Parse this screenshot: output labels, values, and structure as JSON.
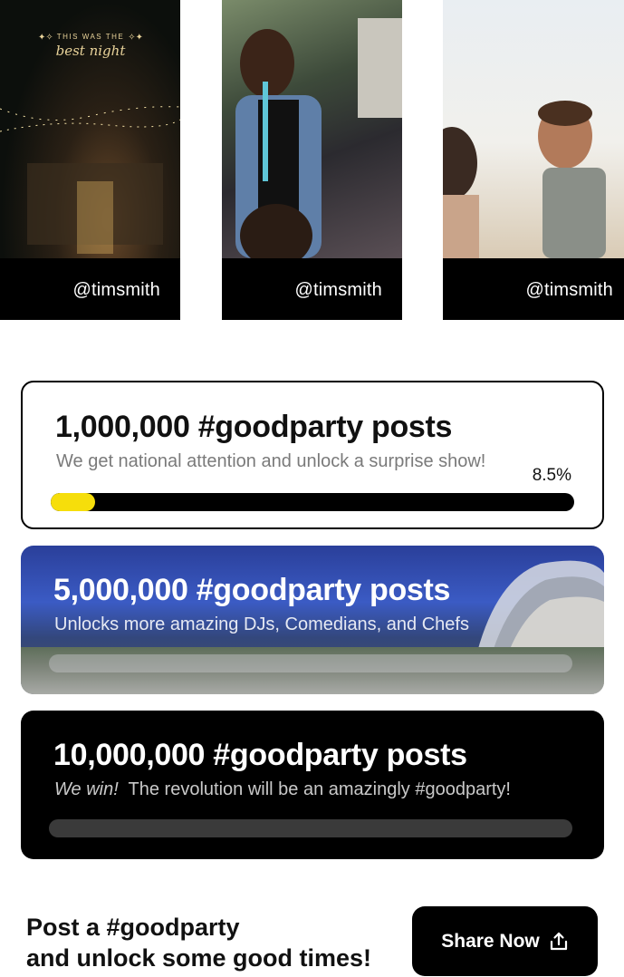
{
  "cards": [
    {
      "handle": "@timsmith",
      "overlay_small": "THIS WAS THE",
      "overlay_script": "best night"
    },
    {
      "handle": "@timsmith"
    },
    {
      "handle": "@timsmith"
    }
  ],
  "goals": [
    {
      "title": "1,000,000 #goodparty posts",
      "subtitle": "We get national attention and unlock a surprise show!",
      "progress_label": "8.5%",
      "progress": 0.085
    },
    {
      "title": "5,000,000 #goodparty posts",
      "subtitle": "Unlocks more amazing DJs, Comedians, and Chefs",
      "progress": 0
    },
    {
      "title": "10,000,000 #goodparty posts",
      "subtitle_emphasis": "We win!",
      "subtitle": "The revolution will be an amazingly #goodparty!",
      "progress": 0
    }
  ],
  "cta": {
    "line1": "Post a #goodparty",
    "line2": "and unlock some good times!",
    "button_label": "Share Now",
    "button_icon": "share-upload-icon"
  },
  "colors": {
    "progress_fill": "#f6de0b",
    "accent_dark": "#000000"
  }
}
